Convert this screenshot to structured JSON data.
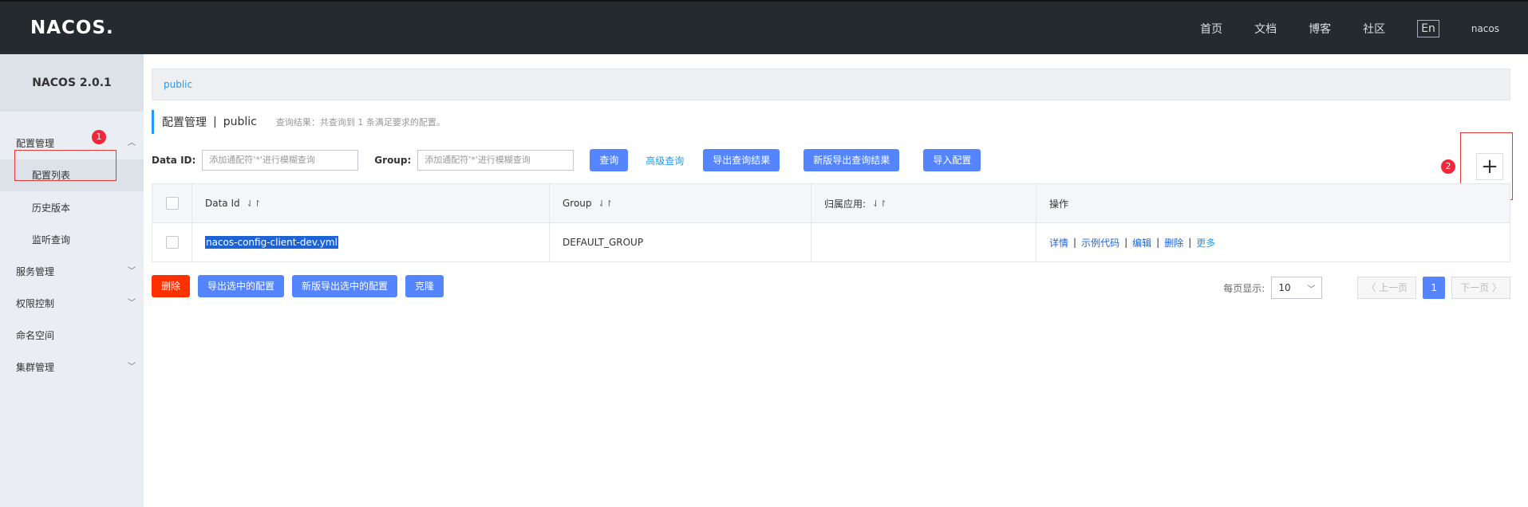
{
  "topbar": {
    "logo": "NACOS.",
    "nav": [
      "首页",
      "文档",
      "博客",
      "社区"
    ],
    "lang": "En",
    "user": "nacos"
  },
  "sidebar": {
    "version": "NACOS 2.0.1",
    "items": [
      {
        "label": "配置管理"
      },
      {
        "label": "配置列表"
      },
      {
        "label": "历史版本"
      },
      {
        "label": "监听查询"
      },
      {
        "label": "服务管理"
      },
      {
        "label": "权限控制"
      },
      {
        "label": "命名空间"
      },
      {
        "label": "集群管理"
      }
    ]
  },
  "breadcrumb": "public",
  "header": {
    "title": "配置管理",
    "separator": "|",
    "namespace": "public",
    "result": "查询结果：共查询到 1 条满足要求的配置。"
  },
  "search": {
    "dataid_label": "Data ID:",
    "dataid_placeholder": "添加通配符'*'进行模糊查询",
    "group_label": "Group:",
    "group_placeholder": "添加通配符'*'进行模糊查询",
    "query": "查询",
    "advanced": "高级查询",
    "export": "导出查询结果",
    "export_new": "新版导出查询结果",
    "import": "导入配置"
  },
  "annotations": {
    "badge1": "1",
    "badge2": "2"
  },
  "add_icon": "plus-icon",
  "table": {
    "headers": [
      "Data Id",
      "Group",
      "归属应用:",
      "操作"
    ],
    "rows": [
      {
        "data_id": "nacos-config-client-dev.yml",
        "group": "DEFAULT_GROUP",
        "app": ""
      }
    ],
    "ops": [
      "详情",
      "示例代码",
      "编辑",
      "删除",
      "更多"
    ]
  },
  "actions": {
    "delete": "删除",
    "export_selected": "导出选中的配置",
    "export_selected_new": "新版导出选中的配置",
    "clone": "克隆"
  },
  "pager": {
    "per_page_label": "每页显示:",
    "per_page": "10",
    "prev": "〈 上一页",
    "page": "1",
    "next": "下一页 〉"
  },
  "colors": {
    "accent": "#5584ff",
    "danger": "#ff3000",
    "link": "#209bfa",
    "topbar": "#252a2f"
  }
}
